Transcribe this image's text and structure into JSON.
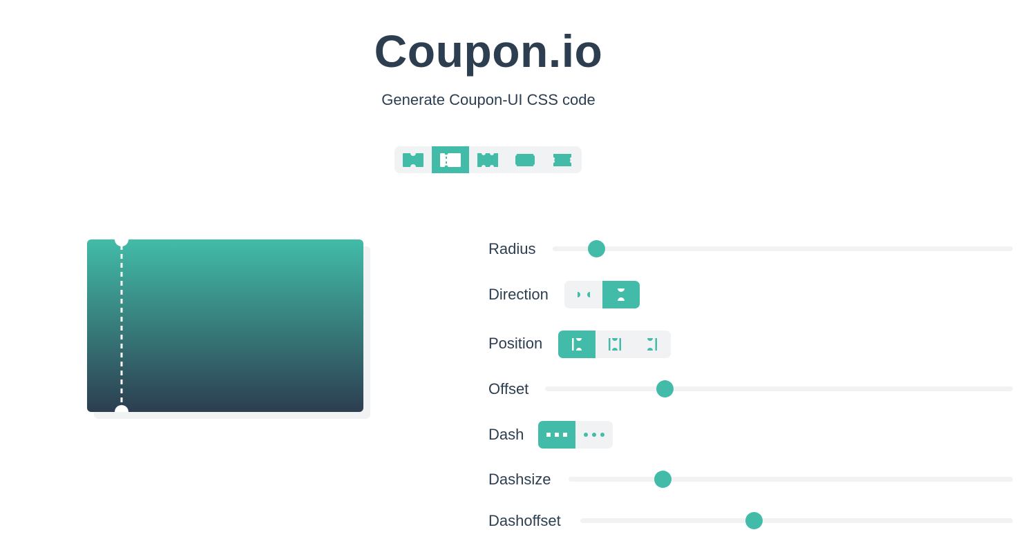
{
  "header": {
    "title": "Coupon.io",
    "subtitle": "Generate Coupon-UI CSS code"
  },
  "coupon_types": {
    "selected_index": 1,
    "items": [
      {
        "icon": "coupon-notch-top-bottom-icon"
      },
      {
        "icon": "coupon-perforated-icon"
      },
      {
        "icon": "coupon-scalloped-icon"
      },
      {
        "icon": "coupon-rounded-corners-icon"
      },
      {
        "icon": "coupon-wavy-edge-icon"
      }
    ]
  },
  "preview": {
    "gradient_top": "#42bca8",
    "gradient_bottom": "#2c3e50"
  },
  "controls": {
    "radius": {
      "label": "Radius",
      "value": 0.095
    },
    "direction": {
      "label": "Direction",
      "selected": "vertical",
      "options": [
        "horizontal-notch-icon",
        "vertical-notch-icon"
      ]
    },
    "position": {
      "label": "Position",
      "selected": "start",
      "options": [
        "position-start-icon",
        "position-center-icon",
        "position-end-icon"
      ]
    },
    "offset": {
      "label": "Offset",
      "value": 0.257
    },
    "dash": {
      "label": "Dash",
      "selected": "square",
      "options": [
        "dash-square-icon",
        "dash-dot-icon"
      ]
    },
    "dashsize": {
      "label": "Dashsize",
      "value": 0.213
    },
    "dashoffset": {
      "label": "Dashoffset",
      "value": 0.401
    }
  },
  "colors": {
    "accent": "#42bca8",
    "text": "#2c3e50",
    "track": "#f1f2f3"
  }
}
